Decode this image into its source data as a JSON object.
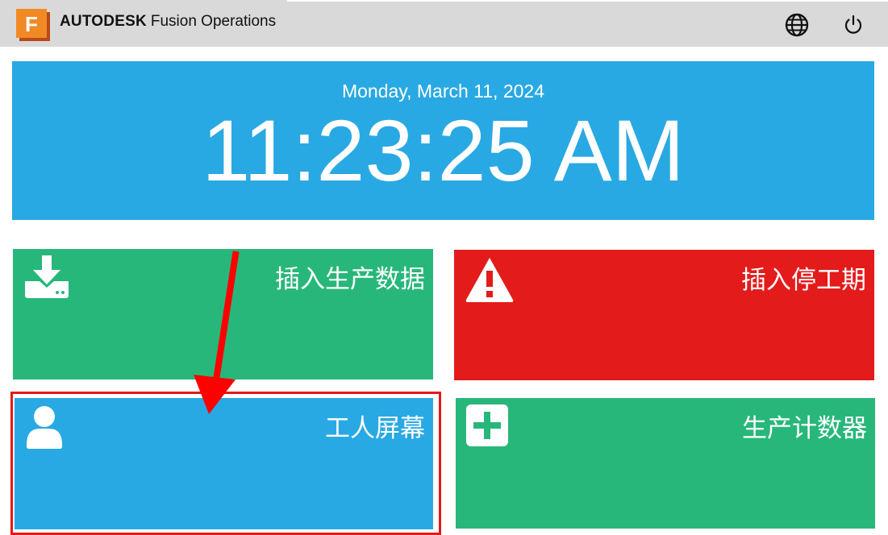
{
  "header": {
    "brand_bold": "AUTODESK",
    "brand_product": "Fusion Operations",
    "logo_letter": "F",
    "logo_icon": "fusion-logo",
    "globe_icon": "globe-icon",
    "power_icon": "power-icon"
  },
  "clock": {
    "date": "Monday, March 11, 2024",
    "time": "11:23:25 AM"
  },
  "tiles": [
    {
      "label": "插入生产数据",
      "icon": "download-icon",
      "color": "#28b77a"
    },
    {
      "label": "插入停工期",
      "icon": "warning-icon",
      "color": "#e41b1b"
    },
    {
      "label": "工人屏幕",
      "icon": "user-icon",
      "color": "#29a9e3"
    },
    {
      "label": "生产计数器",
      "icon": "plus-square-icon",
      "color": "#28b77a"
    }
  ],
  "annotation": {
    "arrow_color": "#ff0000",
    "highlight_color": "#e11b1b"
  }
}
